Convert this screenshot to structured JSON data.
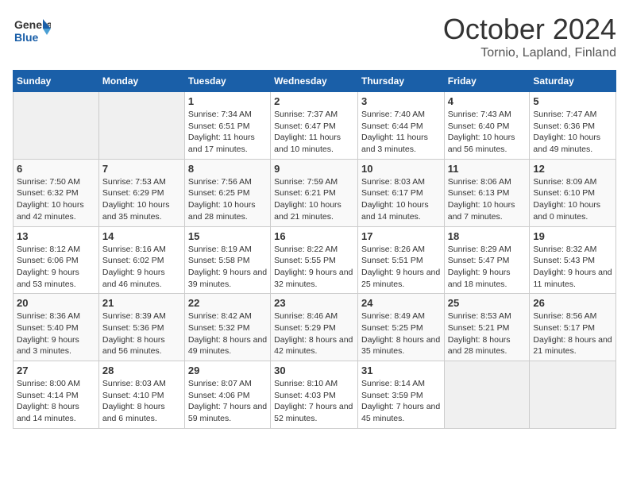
{
  "header": {
    "logo_general": "General",
    "logo_blue": "Blue",
    "month_title": "October 2024",
    "location": "Tornio, Lapland, Finland"
  },
  "days_of_week": [
    "Sunday",
    "Monday",
    "Tuesday",
    "Wednesday",
    "Thursday",
    "Friday",
    "Saturday"
  ],
  "weeks": [
    [
      {
        "day": "",
        "info": ""
      },
      {
        "day": "",
        "info": ""
      },
      {
        "day": "1",
        "info": "Sunrise: 7:34 AM\nSunset: 6:51 PM\nDaylight: 11 hours and 17 minutes."
      },
      {
        "day": "2",
        "info": "Sunrise: 7:37 AM\nSunset: 6:47 PM\nDaylight: 11 hours and 10 minutes."
      },
      {
        "day": "3",
        "info": "Sunrise: 7:40 AM\nSunset: 6:44 PM\nDaylight: 11 hours and 3 minutes."
      },
      {
        "day": "4",
        "info": "Sunrise: 7:43 AM\nSunset: 6:40 PM\nDaylight: 10 hours and 56 minutes."
      },
      {
        "day": "5",
        "info": "Sunrise: 7:47 AM\nSunset: 6:36 PM\nDaylight: 10 hours and 49 minutes."
      }
    ],
    [
      {
        "day": "6",
        "info": "Sunrise: 7:50 AM\nSunset: 6:32 PM\nDaylight: 10 hours and 42 minutes."
      },
      {
        "day": "7",
        "info": "Sunrise: 7:53 AM\nSunset: 6:29 PM\nDaylight: 10 hours and 35 minutes."
      },
      {
        "day": "8",
        "info": "Sunrise: 7:56 AM\nSunset: 6:25 PM\nDaylight: 10 hours and 28 minutes."
      },
      {
        "day": "9",
        "info": "Sunrise: 7:59 AM\nSunset: 6:21 PM\nDaylight: 10 hours and 21 minutes."
      },
      {
        "day": "10",
        "info": "Sunrise: 8:03 AM\nSunset: 6:17 PM\nDaylight: 10 hours and 14 minutes."
      },
      {
        "day": "11",
        "info": "Sunrise: 8:06 AM\nSunset: 6:13 PM\nDaylight: 10 hours and 7 minutes."
      },
      {
        "day": "12",
        "info": "Sunrise: 8:09 AM\nSunset: 6:10 PM\nDaylight: 10 hours and 0 minutes."
      }
    ],
    [
      {
        "day": "13",
        "info": "Sunrise: 8:12 AM\nSunset: 6:06 PM\nDaylight: 9 hours and 53 minutes."
      },
      {
        "day": "14",
        "info": "Sunrise: 8:16 AM\nSunset: 6:02 PM\nDaylight: 9 hours and 46 minutes."
      },
      {
        "day": "15",
        "info": "Sunrise: 8:19 AM\nSunset: 5:58 PM\nDaylight: 9 hours and 39 minutes."
      },
      {
        "day": "16",
        "info": "Sunrise: 8:22 AM\nSunset: 5:55 PM\nDaylight: 9 hours and 32 minutes."
      },
      {
        "day": "17",
        "info": "Sunrise: 8:26 AM\nSunset: 5:51 PM\nDaylight: 9 hours and 25 minutes."
      },
      {
        "day": "18",
        "info": "Sunrise: 8:29 AM\nSunset: 5:47 PM\nDaylight: 9 hours and 18 minutes."
      },
      {
        "day": "19",
        "info": "Sunrise: 8:32 AM\nSunset: 5:43 PM\nDaylight: 9 hours and 11 minutes."
      }
    ],
    [
      {
        "day": "20",
        "info": "Sunrise: 8:36 AM\nSunset: 5:40 PM\nDaylight: 9 hours and 3 minutes."
      },
      {
        "day": "21",
        "info": "Sunrise: 8:39 AM\nSunset: 5:36 PM\nDaylight: 8 hours and 56 minutes."
      },
      {
        "day": "22",
        "info": "Sunrise: 8:42 AM\nSunset: 5:32 PM\nDaylight: 8 hours and 49 minutes."
      },
      {
        "day": "23",
        "info": "Sunrise: 8:46 AM\nSunset: 5:29 PM\nDaylight: 8 hours and 42 minutes."
      },
      {
        "day": "24",
        "info": "Sunrise: 8:49 AM\nSunset: 5:25 PM\nDaylight: 8 hours and 35 minutes."
      },
      {
        "day": "25",
        "info": "Sunrise: 8:53 AM\nSunset: 5:21 PM\nDaylight: 8 hours and 28 minutes."
      },
      {
        "day": "26",
        "info": "Sunrise: 8:56 AM\nSunset: 5:17 PM\nDaylight: 8 hours and 21 minutes."
      }
    ],
    [
      {
        "day": "27",
        "info": "Sunrise: 8:00 AM\nSunset: 4:14 PM\nDaylight: 8 hours and 14 minutes."
      },
      {
        "day": "28",
        "info": "Sunrise: 8:03 AM\nSunset: 4:10 PM\nDaylight: 8 hours and 6 minutes."
      },
      {
        "day": "29",
        "info": "Sunrise: 8:07 AM\nSunset: 4:06 PM\nDaylight: 7 hours and 59 minutes."
      },
      {
        "day": "30",
        "info": "Sunrise: 8:10 AM\nSunset: 4:03 PM\nDaylight: 7 hours and 52 minutes."
      },
      {
        "day": "31",
        "info": "Sunrise: 8:14 AM\nSunset: 3:59 PM\nDaylight: 7 hours and 45 minutes."
      },
      {
        "day": "",
        "info": ""
      },
      {
        "day": "",
        "info": ""
      }
    ]
  ]
}
